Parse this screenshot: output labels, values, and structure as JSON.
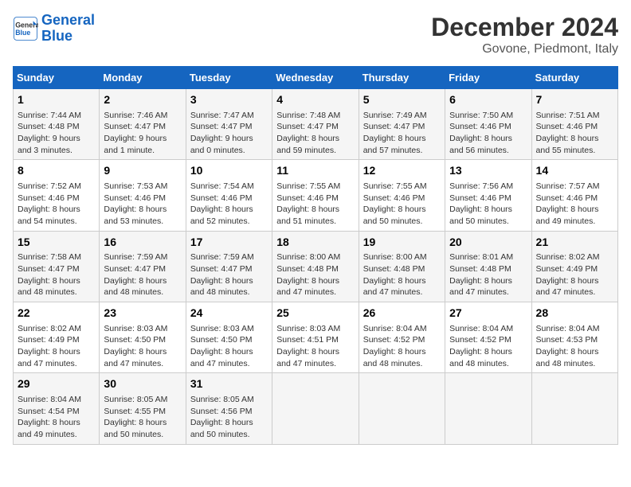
{
  "header": {
    "logo_line1": "General",
    "logo_line2": "Blue",
    "calendar_title": "December 2024",
    "calendar_subtitle": "Govone, Piedmont, Italy"
  },
  "days_of_week": [
    "Sunday",
    "Monday",
    "Tuesday",
    "Wednesday",
    "Thursday",
    "Friday",
    "Saturday"
  ],
  "weeks": [
    [
      {
        "day": "1",
        "info": "Sunrise: 7:44 AM\nSunset: 4:48 PM\nDaylight: 9 hours\nand 3 minutes."
      },
      {
        "day": "2",
        "info": "Sunrise: 7:46 AM\nSunset: 4:47 PM\nDaylight: 9 hours\nand 1 minute."
      },
      {
        "day": "3",
        "info": "Sunrise: 7:47 AM\nSunset: 4:47 PM\nDaylight: 9 hours\nand 0 minutes."
      },
      {
        "day": "4",
        "info": "Sunrise: 7:48 AM\nSunset: 4:47 PM\nDaylight: 8 hours\nand 59 minutes."
      },
      {
        "day": "5",
        "info": "Sunrise: 7:49 AM\nSunset: 4:47 PM\nDaylight: 8 hours\nand 57 minutes."
      },
      {
        "day": "6",
        "info": "Sunrise: 7:50 AM\nSunset: 4:46 PM\nDaylight: 8 hours\nand 56 minutes."
      },
      {
        "day": "7",
        "info": "Sunrise: 7:51 AM\nSunset: 4:46 PM\nDaylight: 8 hours\nand 55 minutes."
      }
    ],
    [
      {
        "day": "8",
        "info": "Sunrise: 7:52 AM\nSunset: 4:46 PM\nDaylight: 8 hours\nand 54 minutes."
      },
      {
        "day": "9",
        "info": "Sunrise: 7:53 AM\nSunset: 4:46 PM\nDaylight: 8 hours\nand 53 minutes."
      },
      {
        "day": "10",
        "info": "Sunrise: 7:54 AM\nSunset: 4:46 PM\nDaylight: 8 hours\nand 52 minutes."
      },
      {
        "day": "11",
        "info": "Sunrise: 7:55 AM\nSunset: 4:46 PM\nDaylight: 8 hours\nand 51 minutes."
      },
      {
        "day": "12",
        "info": "Sunrise: 7:55 AM\nSunset: 4:46 PM\nDaylight: 8 hours\nand 50 minutes."
      },
      {
        "day": "13",
        "info": "Sunrise: 7:56 AM\nSunset: 4:46 PM\nDaylight: 8 hours\nand 50 minutes."
      },
      {
        "day": "14",
        "info": "Sunrise: 7:57 AM\nSunset: 4:46 PM\nDaylight: 8 hours\nand 49 minutes."
      }
    ],
    [
      {
        "day": "15",
        "info": "Sunrise: 7:58 AM\nSunset: 4:47 PM\nDaylight: 8 hours\nand 48 minutes."
      },
      {
        "day": "16",
        "info": "Sunrise: 7:59 AM\nSunset: 4:47 PM\nDaylight: 8 hours\nand 48 minutes."
      },
      {
        "day": "17",
        "info": "Sunrise: 7:59 AM\nSunset: 4:47 PM\nDaylight: 8 hours\nand 48 minutes."
      },
      {
        "day": "18",
        "info": "Sunrise: 8:00 AM\nSunset: 4:48 PM\nDaylight: 8 hours\nand 47 minutes."
      },
      {
        "day": "19",
        "info": "Sunrise: 8:00 AM\nSunset: 4:48 PM\nDaylight: 8 hours\nand 47 minutes."
      },
      {
        "day": "20",
        "info": "Sunrise: 8:01 AM\nSunset: 4:48 PM\nDaylight: 8 hours\nand 47 minutes."
      },
      {
        "day": "21",
        "info": "Sunrise: 8:02 AM\nSunset: 4:49 PM\nDaylight: 8 hours\nand 47 minutes."
      }
    ],
    [
      {
        "day": "22",
        "info": "Sunrise: 8:02 AM\nSunset: 4:49 PM\nDaylight: 8 hours\nand 47 minutes."
      },
      {
        "day": "23",
        "info": "Sunrise: 8:03 AM\nSunset: 4:50 PM\nDaylight: 8 hours\nand 47 minutes."
      },
      {
        "day": "24",
        "info": "Sunrise: 8:03 AM\nSunset: 4:50 PM\nDaylight: 8 hours\nand 47 minutes."
      },
      {
        "day": "25",
        "info": "Sunrise: 8:03 AM\nSunset: 4:51 PM\nDaylight: 8 hours\nand 47 minutes."
      },
      {
        "day": "26",
        "info": "Sunrise: 8:04 AM\nSunset: 4:52 PM\nDaylight: 8 hours\nand 48 minutes."
      },
      {
        "day": "27",
        "info": "Sunrise: 8:04 AM\nSunset: 4:52 PM\nDaylight: 8 hours\nand 48 minutes."
      },
      {
        "day": "28",
        "info": "Sunrise: 8:04 AM\nSunset: 4:53 PM\nDaylight: 8 hours\nand 48 minutes."
      }
    ],
    [
      {
        "day": "29",
        "info": "Sunrise: 8:04 AM\nSunset: 4:54 PM\nDaylight: 8 hours\nand 49 minutes."
      },
      {
        "day": "30",
        "info": "Sunrise: 8:05 AM\nSunset: 4:55 PM\nDaylight: 8 hours\nand 50 minutes."
      },
      {
        "day": "31",
        "info": "Sunrise: 8:05 AM\nSunset: 4:56 PM\nDaylight: 8 hours\nand 50 minutes."
      },
      null,
      null,
      null,
      null
    ]
  ]
}
